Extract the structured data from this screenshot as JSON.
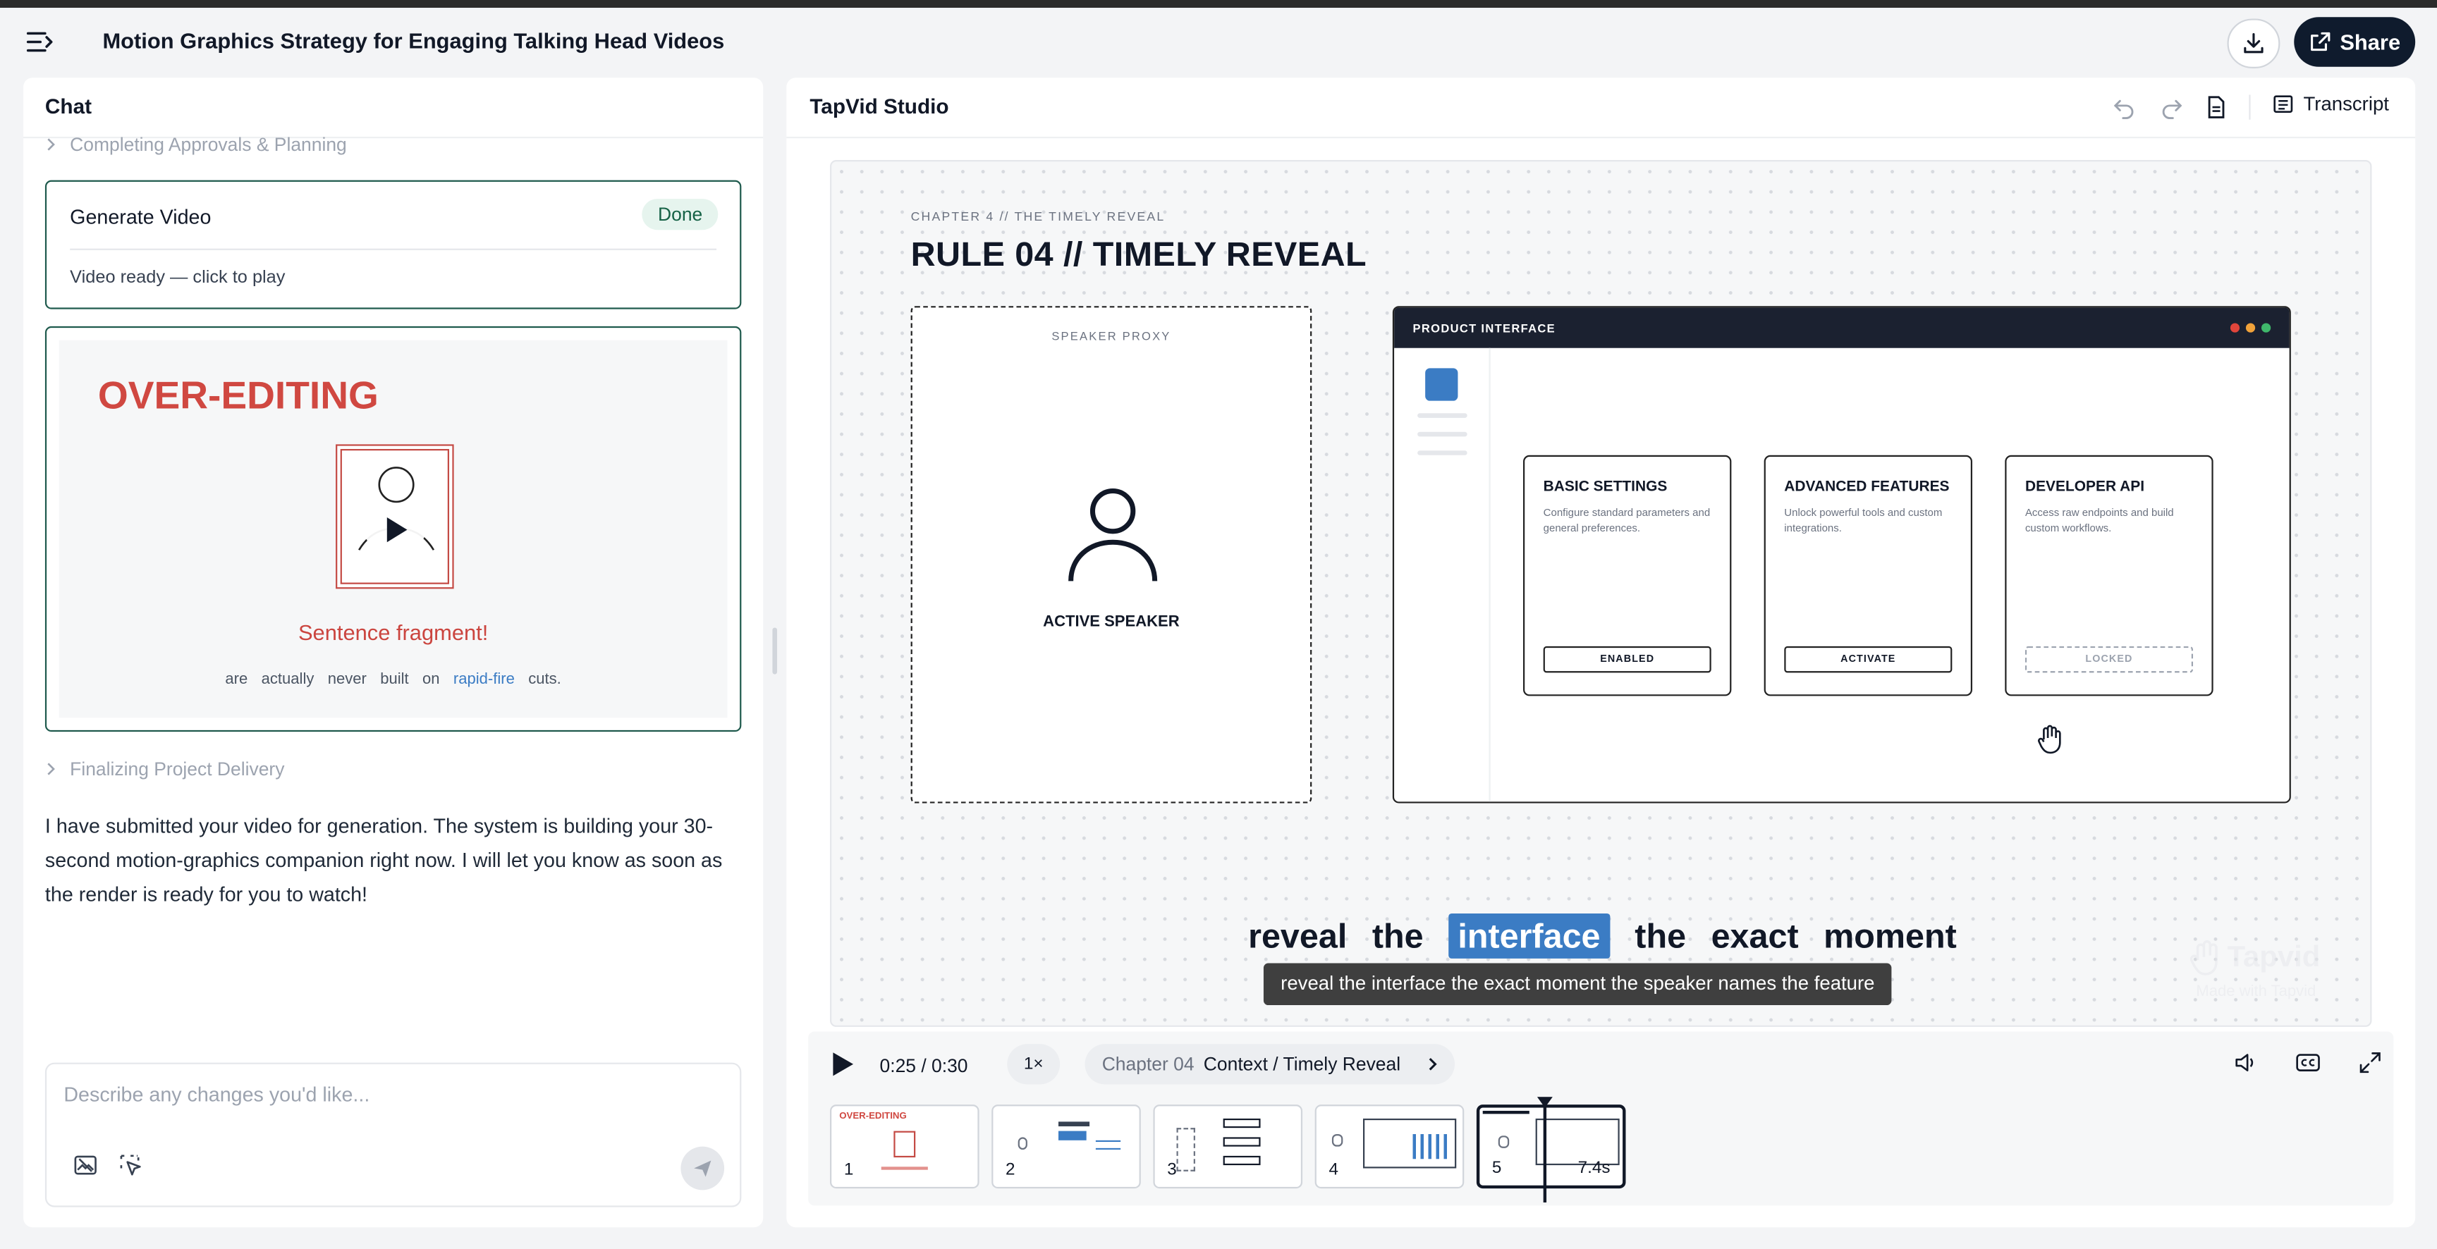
{
  "header": {
    "title": "Motion Graphics Strategy for Engaging Talking Head Videos",
    "share_label": "Share"
  },
  "chat": {
    "title": "Chat",
    "step_before": "Completing Approvals & Planning",
    "generate_card": {
      "title": "Generate Video",
      "badge": "Done",
      "status": "Video ready — click to play"
    },
    "preview": {
      "title": "OVER-EDITING",
      "sentence": "Sentence fragment!",
      "words": [
        "are",
        "actually",
        "never",
        "built",
        "on"
      ],
      "highlight_word": "rapid-fire",
      "last_word": "cuts."
    },
    "step_after": "Finalizing Project Delivery",
    "message": "I have submitted your video for generation. The system is building your 30-second motion-graphics companion right now. I will let you know as soon as the render is ready for you to watch!",
    "composer_placeholder": "Describe any changes you'd like..."
  },
  "studio": {
    "title": "TapVid Studio",
    "transcript_label": "Transcript",
    "scene": {
      "chapter_label": "CHAPTER 4 // THE TIMELY REVEAL",
      "rule_title": "RULE 04 // TIMELY REVEAL",
      "speaker_proxy": "SPEAKER PROXY",
      "speaker_name": "ACTIVE SPEAKER",
      "product_title": "PRODUCT INTERFACE",
      "cards": [
        {
          "title": "BASIC SETTINGS",
          "desc": "Configure standard parameters and general preferences.",
          "button": "ENABLED",
          "locked": false
        },
        {
          "title": "ADVANCED FEATURES",
          "desc": "Unlock powerful tools and custom integrations.",
          "button": "ACTIVATE",
          "locked": false
        },
        {
          "title": "DEVELOPER API",
          "desc": "Access raw endpoints and build custom workflows.",
          "button": "LOCKED",
          "locked": true
        }
      ],
      "caption_words": [
        "reveal",
        "the",
        "interface",
        "the",
        "exact",
        "moment"
      ],
      "caption_active_index": 2,
      "caption_full": "reveal the interface the exact moment the speaker names the feature",
      "watermark_name": "Tapvid",
      "watermark_sub": "Made with Tapvid"
    },
    "controls": {
      "time": "0:25 / 0:30",
      "speed": "1×",
      "chapter_num": "Chapter 04",
      "chapter_name": "Context / Timely Reveal"
    },
    "thumbnails": [
      {
        "num": "1",
        "label": "OVER-EDITING",
        "duration": ""
      },
      {
        "num": "2",
        "label": "",
        "duration": ""
      },
      {
        "num": "3",
        "label": "",
        "duration": ""
      },
      {
        "num": "4",
        "label": "",
        "duration": ""
      },
      {
        "num": "5",
        "label": "",
        "duration": "7.4s"
      }
    ],
    "active_thumbnail": 4
  },
  "colors": {
    "accent_green": "#1f5a4d",
    "brand_dark": "#0f1b2d",
    "accent_red": "#d04841",
    "highlight_blue": "#3b7cc4"
  }
}
